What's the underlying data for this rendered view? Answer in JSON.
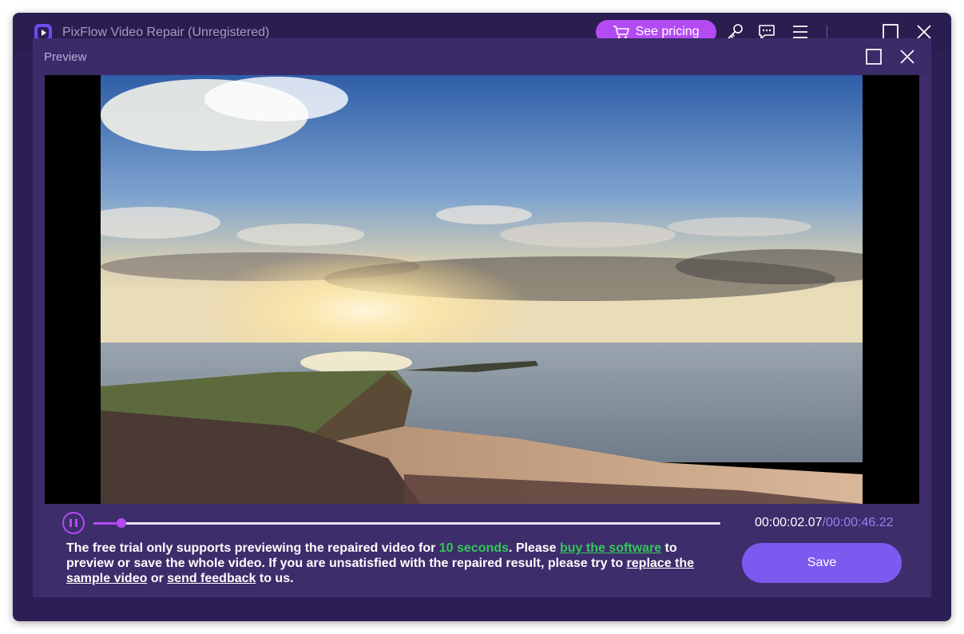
{
  "app": {
    "title": "PixFlow Video Repair (Unregistered)",
    "pricing_label": "See pricing",
    "icons": [
      "app-logo-icon",
      "cart-icon",
      "key-icon",
      "feedback-icon",
      "menu-icon",
      "minimize-icon",
      "maximize-icon",
      "close-icon"
    ]
  },
  "preview": {
    "title": "Preview",
    "icons": [
      "maximize-icon",
      "close-icon"
    ]
  },
  "player": {
    "state": "playing",
    "progress_fraction": 0.045,
    "time_current": "00:00:02.07",
    "time_separator": "/",
    "time_total": "00:00:46.22"
  },
  "notice": {
    "part1": "The free trial only supports previewing the repaired video for ",
    "highlight": "10 seconds",
    "part2": ". Please ",
    "link_buy": "buy the software",
    "part3": " to preview or save the whole video. If you are unsatisfied with the repaired result, please try to ",
    "link_replace": "replace the sample video",
    "part4": " or ",
    "link_feedback": "send feedback",
    "part5": " to us."
  },
  "actions": {
    "save_label": "Save"
  },
  "colors": {
    "accent_purple": "#b44bf2",
    "save_button": "#7c5af0",
    "highlight_green": "#34c759",
    "panel_bg": "#3d2d6b",
    "window_bg": "#2c1f55"
  }
}
